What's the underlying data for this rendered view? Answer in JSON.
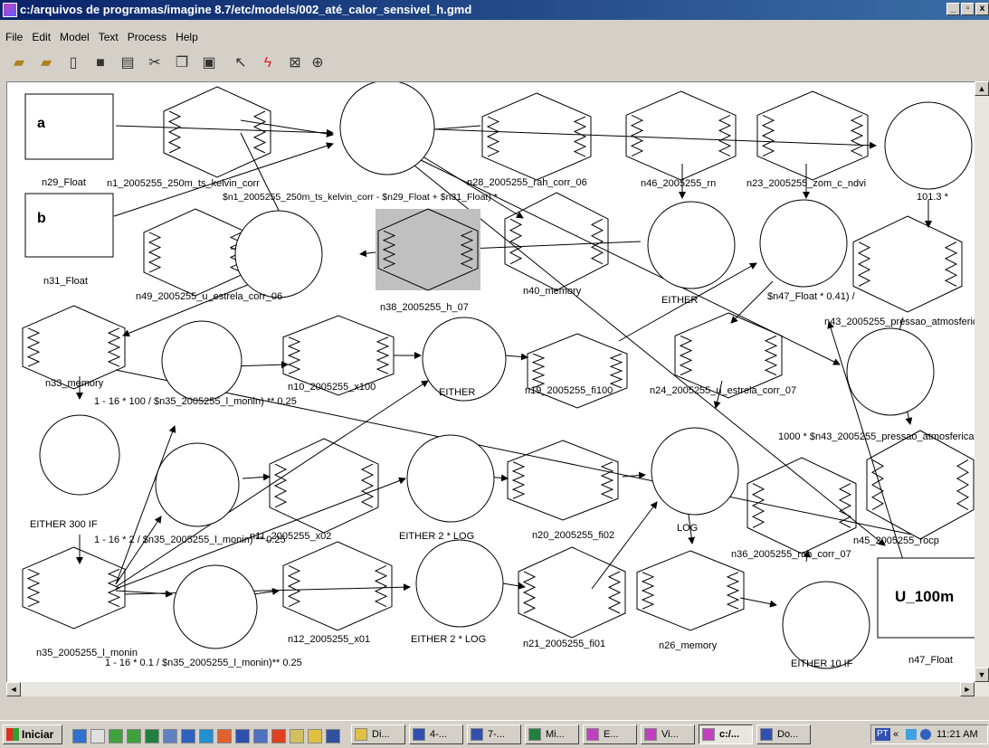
{
  "window": {
    "title": "c:/arquivos de programas/imagine 8.7/etc/models/002_até_calor_sensivel_h.gmd",
    "minimize_label": "_",
    "maximize_label": "▫",
    "close_label": "x"
  },
  "menu": {
    "items": [
      "File",
      "Edit",
      "Model",
      "Text",
      "Process",
      "Help"
    ]
  },
  "toolbar": {
    "icons": [
      "open-folder-icon",
      "open-model-icon",
      "new-icon",
      "save-icon",
      "print-icon",
      "cut-icon",
      "copy-icon",
      "paste-icon",
      "select-arrow-icon",
      "run-lightning-icon",
      "zoom-fit-icon",
      "zoom-icon"
    ]
  },
  "model": {
    "input_boxes": {
      "a": "a",
      "b": "b",
      "u": "U_100m"
    },
    "labels": {
      "n29": "n29_Float",
      "n31": "n31_Float",
      "n47": "n47_Float",
      "n1": "n1_2005255_250m_ts_kelvin_corr",
      "n28": "n28_2005255_rah_corr_06",
      "n46": "n46_2005255_rn",
      "n23": "n23_2005255_zom_c_ndvi",
      "n49": "n49_2005255_u_estrela_corr_06",
      "n38": "n38_2005255_h_07",
      "n40": "n40_memory",
      "n43": "n43_2005255_pressao_atmosferic",
      "n33": "n33_memory",
      "n10": "n10_2005255_x100",
      "n19": "n19_2005255_fi100",
      "n24": "n24_2005255_u_estrela_corr_07",
      "n11": "n11_2005255_x02",
      "n20": "n20_2005255_fi02",
      "n36": "n36_2005255_rah_corr_07",
      "n45": "n45_2005255_rocp",
      "n12": "n12_2005255_x01",
      "n21": "n21_2005255_fi01",
      "n26": "n26_memory",
      "n35": "n35_2005255_l_monin"
    },
    "functions": {
      "f1": "$n1_2005255_250m_ts_kelvin_corr - $n29_Float + $n31_Float) *",
      "f2": "101.3 *",
      "f3": "EITHER",
      "f4": "$n47_Float * 0.41) /",
      "f5": "EITHER",
      "f6": "1 - 16 * 100 / $n35_2005255_l_monin) ** 0.25",
      "f7": "EITHER 300 IF",
      "f8": "1000 * $n43_2005255_pressao_atmosferica",
      "f9": "1 - 16 * 2 / $n35_2005255_l_monin) ** 0.25",
      "f10": "EITHER 2 * LOG",
      "f11": "LOG",
      "f12": "1 - 16 * 0.1 / $n35_2005255_l_monin)** 0.25",
      "f13": "EITHER 2 * LOG",
      "f14": "EITHER 10 IF"
    }
  },
  "taskbar": {
    "start_label": "Iniciar",
    "tasks": [
      "Di...",
      "4-...",
      "7-...",
      "Mi...",
      "E...",
      "Vi...",
      "c:/...",
      "Do..."
    ],
    "tray_time": "11:21 AM",
    "tray_text": "PT"
  },
  "colors": {
    "titlebar_start": "#0a246a",
    "titlebar_end": "#3a6ea5",
    "selected_node": "#c0c0c0"
  }
}
